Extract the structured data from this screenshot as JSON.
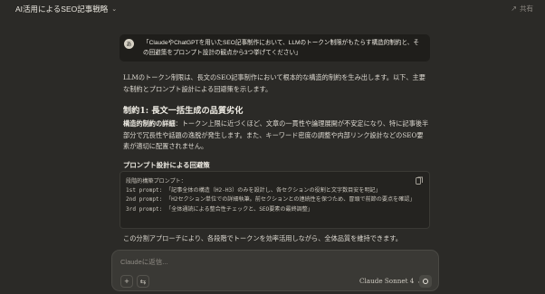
{
  "header": {
    "title": "AI活用によるSEO記事戦略",
    "share_label": "共有"
  },
  "user_message": {
    "avatar_initial": "あ",
    "text": "「ClaudeやChatGPTを用いたSEO記事制作において、LLMのトークン制限がもたらす構造的制約と、その回避策をプロンプト設計の観点から3つ挙げてください」"
  },
  "response": {
    "intro": "LLMのトークン制限は、長文のSEO記事制作において根本的な構造的制約を生み出します。以下、主要な制約とプロンプト設計による回避策を示します。",
    "heading1": "制約1: 長文一括生成の品質劣化",
    "p2_bold": "構造的制約の詳細",
    "p2_rest": "：トークン上限に近づくほど、文章の一貫性や論理展開が不安定になり、特に記事後半部分で冗長性や話題の逸脱が発生します。また、キーワード密度の調整や内部リンク設計などのSEO要素が適切に配置されません。",
    "heading2": "プロンプト設計による回避策",
    "code": {
      "line1": "段階的構築プロンプト：",
      "line2": "1st prompt: 「記事全体の構造（H2-H3）のみを設計し、各セクションの役割と文字数目安を明記」",
      "line3": "2nd prompt: 「H2セクション単位での詳細執筆。前セクションとの連続性を保つため、冒頭で前節の要点を確認」",
      "line4": "3rd prompt: 「全体通読による整合性チェックと、SEO要素の最終調整」"
    },
    "after": "この分割アプローチにより、各段階でトークンを効率活用しながら、全体品質を維持できます。"
  },
  "composer": {
    "placeholder": "Claudeに返信...",
    "add_label": "+",
    "tools_label": "⇆",
    "model": "Claude Sonnet 4",
    "model_chevron": "⌄"
  },
  "icons": {
    "title_chevron": "chevron-down-icon",
    "share": "share-arrow-icon",
    "copy": "copy-icon",
    "send": "send-icon"
  }
}
